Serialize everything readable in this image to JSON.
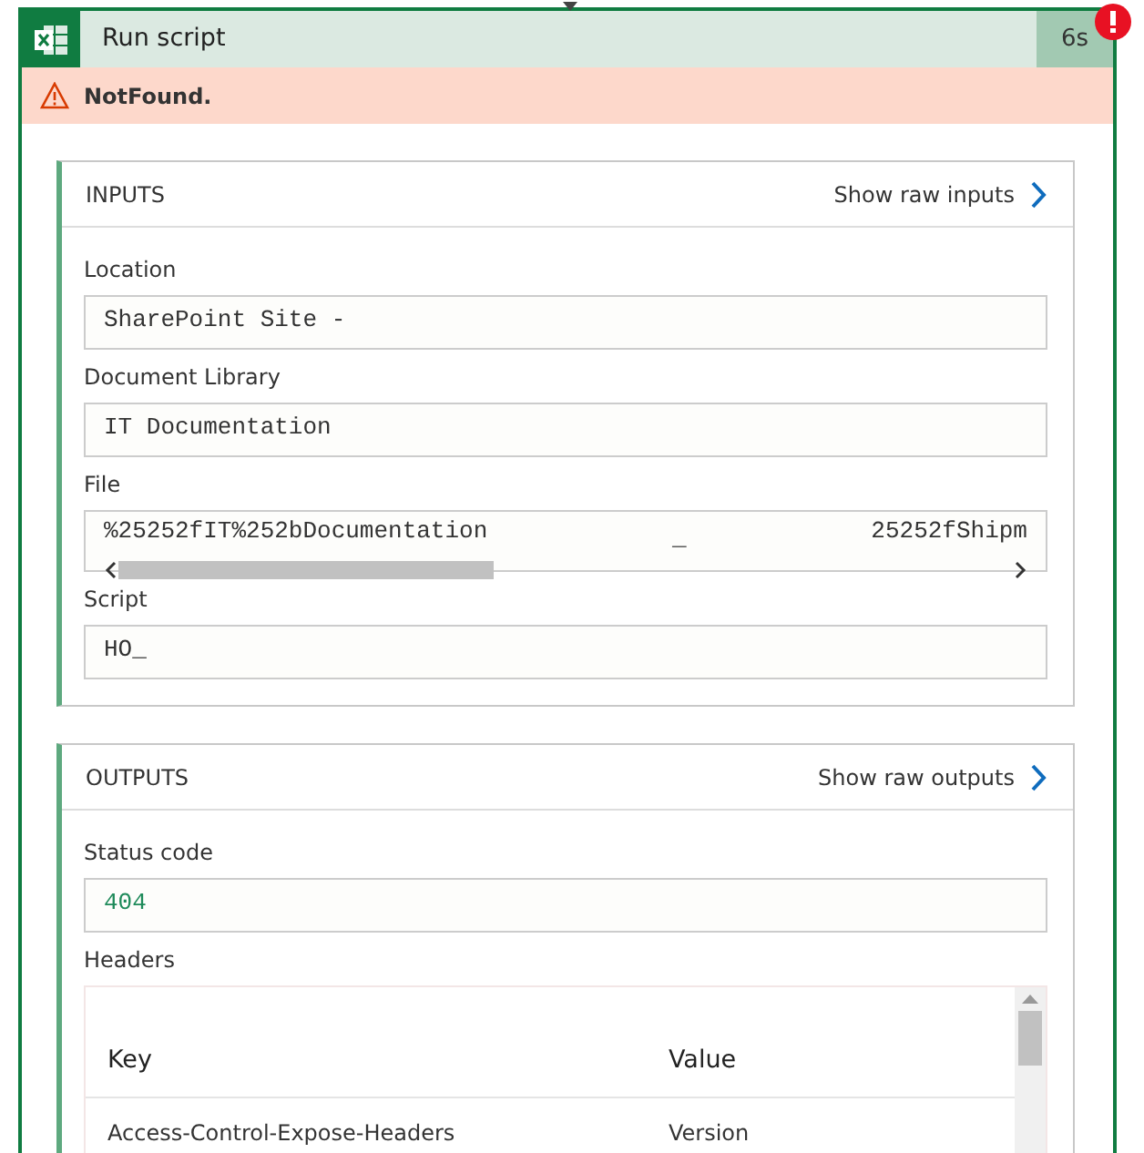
{
  "action": {
    "title": "Run script",
    "duration": "6s",
    "failed": true
  },
  "error": {
    "message": "NotFound."
  },
  "inputs": {
    "title": "INPUTS",
    "link": "Show raw inputs",
    "fields": [
      {
        "kind": "text",
        "label": "Location",
        "value": "SharePoint Site -"
      },
      {
        "kind": "text",
        "label": "Document Library",
        "value": "IT Documentation"
      },
      {
        "kind": "scroll",
        "label": "File",
        "parts": [
          "%25252fIT%252bDocumentation",
          "_",
          "25252fShipm"
        ]
      },
      {
        "kind": "text",
        "label": "Script",
        "value": "HO_"
      }
    ]
  },
  "outputs": {
    "title": "OUTPUTS",
    "link": "Show raw outputs",
    "fields": [
      {
        "kind": "code",
        "label": "Status code",
        "value": "404"
      }
    ],
    "headers": {
      "label": "Headers",
      "columns": [
        "Key",
        "Value"
      ],
      "rows": [
        [
          "Access-Control-Expose-Headers",
          "Version"
        ]
      ]
    }
  }
}
